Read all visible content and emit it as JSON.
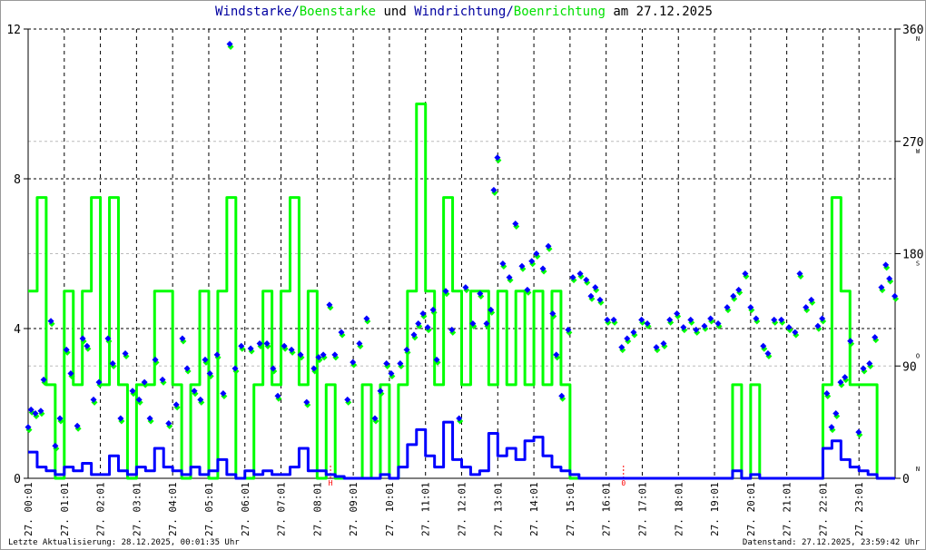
{
  "title": {
    "part1": "Windstarke",
    "sep1": "/",
    "part2": "Boenstarke",
    "mid": " und ",
    "part3": "Windrichtung",
    "sep2": "/",
    "part4": "Boenrichtung",
    "tail": " am 27.12.2025"
  },
  "footer": {
    "last_update": "Letzte Aktualisierung: 28.12.2025, 00:01:35 Uhr",
    "data_state": "Datenstand: 27.12.2025, 23:59:42 Uhr"
  },
  "colors": {
    "wind": "#0000ff",
    "gust": "#00ff00",
    "title_wind": "#0000a0",
    "marker": "#ff0000",
    "grid": "#000000",
    "grid_light": "#bbbbbb"
  },
  "chart_data": {
    "type": "line",
    "title": "Windstarke/Boenstarke und Windrichtung/Boenrichtung am 27.12.2025",
    "xlim_hours": [
      0,
      24
    ],
    "x_tick_labels": [
      "27. 00:01",
      "27. 01:01",
      "27. 02:01",
      "27. 03:01",
      "27. 04:01",
      "27. 05:01",
      "27. 06:01",
      "27. 07:01",
      "27. 08:01",
      "27. 09:01",
      "27. 10:01",
      "27. 11:01",
      "27. 12:01",
      "27. 13:01",
      "27. 14:01",
      "27. 15:01",
      "27. 16:01",
      "27. 17:01",
      "27. 18:01",
      "27. 19:01",
      "27. 20:01",
      "27. 21:01",
      "27. 22:01",
      "27. 23:01"
    ],
    "y_left": {
      "range": [
        0,
        12
      ],
      "ticks": [
        "0",
        "4",
        "8",
        "12"
      ],
      "tick_values": [
        0,
        4,
        8,
        12
      ]
    },
    "y_right": {
      "range": [
        0,
        360
      ],
      "ticks": [
        "0",
        "90",
        "180",
        "270",
        "360"
      ],
      "tick_values": [
        0,
        90,
        180,
        270,
        360
      ],
      "compass": [
        "N",
        "O",
        "S",
        "W",
        "N"
      ]
    },
    "interval_minutes": 15,
    "series": [
      {
        "name": "Boenstarke",
        "color": "#00ff00",
        "axis": "left",
        "values": [
          5,
          7.5,
          2.5,
          0,
          5,
          2.5,
          5,
          7.5,
          2.5,
          7.5,
          2.5,
          0,
          2.5,
          2.5,
          5,
          5,
          2.5,
          0,
          2.5,
          5,
          0,
          5,
          7.5,
          0,
          0,
          2.5,
          5,
          2.5,
          5,
          7.5,
          2.5,
          5,
          0,
          2.5,
          0,
          0,
          0,
          2.5,
          0,
          2.5,
          0,
          2.5,
          5,
          10,
          5,
          2.5,
          7.5,
          5,
          2.5,
          5,
          5,
          2.5,
          5,
          2.5,
          5,
          2.5,
          5,
          2.5,
          5,
          2.5,
          0,
          0,
          0,
          0,
          0,
          0,
          0,
          0,
          0,
          0,
          0,
          0,
          0,
          0,
          0,
          0,
          0,
          0,
          2.5,
          0,
          2.5,
          0,
          0,
          0,
          0,
          0,
          0,
          0,
          2.5,
          7.5,
          5,
          2.5,
          2.5,
          2.5,
          0,
          0
        ]
      },
      {
        "name": "Windstarke",
        "color": "#0000ff",
        "axis": "left",
        "values": [
          0.7,
          0.3,
          0.2,
          0.1,
          0.3,
          0.2,
          0.4,
          0.1,
          0.1,
          0.6,
          0.2,
          0.1,
          0.3,
          0.2,
          0.8,
          0.3,
          0.2,
          0.1,
          0.3,
          0.1,
          0.2,
          0.5,
          0.1,
          0,
          0.2,
          0.1,
          0.2,
          0.1,
          0.1,
          0.3,
          0.8,
          0.2,
          0.2,
          0.1,
          0.05,
          0,
          0,
          0,
          0,
          0.1,
          0,
          0.3,
          0.9,
          1.3,
          0.6,
          0.3,
          1.5,
          0.5,
          0.3,
          0.1,
          0.2,
          1.2,
          0.6,
          0.8,
          0.5,
          1.0,
          1.1,
          0.6,
          0.3,
          0.2,
          0.1,
          0,
          0,
          0,
          0,
          0,
          0,
          0,
          0,
          0,
          0,
          0,
          0,
          0,
          0,
          0,
          0,
          0,
          0.2,
          0,
          0.1,
          0,
          0,
          0,
          0,
          0,
          0,
          0,
          0.8,
          1.0,
          0.5,
          0.3,
          0.2,
          0.1,
          0,
          0
        ]
      }
    ],
    "direction_points": [
      [
        0,
        41
      ],
      [
        0.08,
        55
      ],
      [
        0.2,
        52
      ],
      [
        0.35,
        54
      ],
      [
        0.43,
        79
      ],
      [
        0.63,
        126
      ],
      [
        0.75,
        26
      ],
      [
        0.88,
        48
      ],
      [
        1.06,
        103
      ],
      [
        1.18,
        84
      ],
      [
        1.36,
        42
      ],
      [
        1.51,
        112
      ],
      [
        1.63,
        106
      ],
      [
        1.81,
        63
      ],
      [
        1.96,
        77
      ],
      [
        2.21,
        112
      ],
      [
        2.34,
        92
      ],
      [
        2.56,
        48
      ],
      [
        2.69,
        100
      ],
      [
        2.89,
        70
      ],
      [
        3.07,
        63
      ],
      [
        3.22,
        77
      ],
      [
        3.37,
        48
      ],
      [
        3.52,
        95
      ],
      [
        3.72,
        79
      ],
      [
        3.89,
        44
      ],
      [
        4.1,
        59
      ],
      [
        4.27,
        112
      ],
      [
        4.4,
        88
      ],
      [
        4.6,
        70
      ],
      [
        4.77,
        63
      ],
      [
        4.9,
        95
      ],
      [
        5.03,
        84
      ],
      [
        5.23,
        99
      ],
      [
        5.4,
        68
      ],
      [
        5.58,
        348
      ],
      [
        5.73,
        88
      ],
      [
        5.9,
        106
      ],
      [
        6.16,
        104
      ],
      [
        6.41,
        108
      ],
      [
        6.61,
        108
      ],
      [
        6.78,
        88
      ],
      [
        6.91,
        66
      ],
      [
        7.09,
        106
      ],
      [
        7.29,
        103
      ],
      [
        7.54,
        99
      ],
      [
        7.71,
        61
      ],
      [
        7.91,
        88
      ],
      [
        8.04,
        97
      ],
      [
        8.17,
        99
      ],
      [
        8.34,
        139
      ],
      [
        8.49,
        99
      ],
      [
        8.67,
        117
      ],
      [
        8.84,
        63
      ],
      [
        8.99,
        93
      ],
      [
        9.17,
        108
      ],
      [
        9.37,
        128
      ],
      [
        9.6,
        48
      ],
      [
        9.75,
        70
      ],
      [
        9.92,
        92
      ],
      [
        10.05,
        84
      ],
      [
        10.3,
        92
      ],
      [
        10.48,
        103
      ],
      [
        10.68,
        115
      ],
      [
        10.8,
        124
      ],
      [
        10.93,
        132
      ],
      [
        11.06,
        121
      ],
      [
        11.21,
        135
      ],
      [
        11.31,
        95
      ],
      [
        11.56,
        150
      ],
      [
        11.73,
        119
      ],
      [
        11.93,
        48
      ],
      [
        12.11,
        153
      ],
      [
        12.31,
        124
      ],
      [
        12.51,
        148
      ],
      [
        12.69,
        124
      ],
      [
        12.81,
        135
      ],
      [
        12.89,
        231
      ],
      [
        12.99,
        257
      ],
      [
        13.14,
        172
      ],
      [
        13.32,
        161
      ],
      [
        13.49,
        204
      ],
      [
        13.67,
        170
      ],
      [
        13.82,
        151
      ],
      [
        13.94,
        174
      ],
      [
        14.07,
        180
      ],
      [
        14.25,
        168
      ],
      [
        14.4,
        186
      ],
      [
        14.52,
        132
      ],
      [
        14.62,
        99
      ],
      [
        14.77,
        66
      ],
      [
        14.95,
        119
      ],
      [
        15.08,
        161
      ],
      [
        15.28,
        164
      ],
      [
        15.45,
        159
      ],
      [
        15.58,
        146
      ],
      [
        15.7,
        153
      ],
      [
        15.83,
        143
      ],
      [
        16.03,
        127
      ],
      [
        16.21,
        127
      ],
      [
        16.43,
        105
      ],
      [
        16.58,
        112
      ],
      [
        16.76,
        117
      ],
      [
        16.98,
        127
      ],
      [
        17.14,
        124
      ],
      [
        17.39,
        105
      ],
      [
        17.59,
        108
      ],
      [
        17.76,
        127
      ],
      [
        17.96,
        132
      ],
      [
        18.14,
        121
      ],
      [
        18.34,
        127
      ],
      [
        18.49,
        119
      ],
      [
        18.72,
        122
      ],
      [
        18.89,
        128
      ],
      [
        19.1,
        124
      ],
      [
        19.35,
        137
      ],
      [
        19.52,
        146
      ],
      [
        19.67,
        151
      ],
      [
        19.85,
        164
      ],
      [
        20.0,
        137
      ],
      [
        20.15,
        128
      ],
      [
        20.35,
        106
      ],
      [
        20.48,
        100
      ],
      [
        20.65,
        127
      ],
      [
        20.85,
        127
      ],
      [
        21.06,
        121
      ],
      [
        21.23,
        117
      ],
      [
        21.36,
        164
      ],
      [
        21.53,
        137
      ],
      [
        21.68,
        143
      ],
      [
        21.86,
        122
      ],
      [
        21.98,
        128
      ],
      [
        22.11,
        68
      ],
      [
        22.24,
        41
      ],
      [
        22.36,
        52
      ],
      [
        22.49,
        77
      ],
      [
        22.61,
        81
      ],
      [
        22.76,
        110
      ],
      [
        22.99,
        37
      ],
      [
        23.12,
        88
      ],
      [
        23.29,
        92
      ],
      [
        23.44,
        113
      ],
      [
        23.62,
        153
      ],
      [
        23.74,
        171
      ],
      [
        23.84,
        160
      ],
      [
        23.99,
        146
      ]
    ],
    "annotations": [
      {
        "hour": 8.37,
        "label": "H"
      },
      {
        "hour": 16.48,
        "label": "0"
      }
    ],
    "grid": true
  }
}
